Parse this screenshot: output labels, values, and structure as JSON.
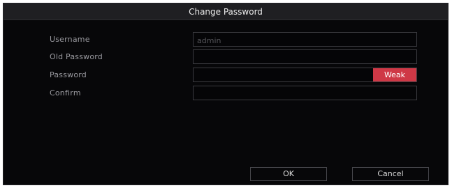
{
  "dialog": {
    "title": "Change Password"
  },
  "form": {
    "username": {
      "label": "Username",
      "value": "admin"
    },
    "old_password": {
      "label": "Old Password",
      "value": ""
    },
    "password": {
      "label": "Password",
      "value": "",
      "strength_label": "Weak",
      "strength_color": "#cf3846"
    },
    "confirm": {
      "label": "Confirm",
      "value": ""
    }
  },
  "buttons": {
    "ok_label": "OK",
    "cancel_label": "Cancel"
  },
  "colors": {
    "background": "#070709",
    "title_bar": "#1f1f22",
    "field_border": "#3b3b40",
    "label_text": "#9a9aa0"
  }
}
